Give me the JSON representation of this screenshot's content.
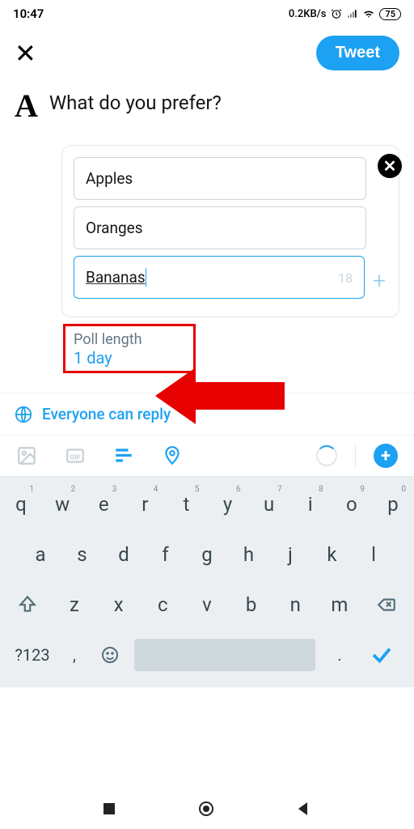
{
  "status": {
    "time": "10:47",
    "speed": "0.2KB/s",
    "battery": "75"
  },
  "header": {
    "tweet_label": "Tweet"
  },
  "compose": {
    "text": "What do you prefer?"
  },
  "poll": {
    "choices": [
      "Apples",
      "Oranges",
      "Bananas"
    ],
    "active_char_count": "18",
    "length_label": "Poll length",
    "length_value": "1 day"
  },
  "reply": {
    "label": "Everyone can reply"
  },
  "keyboard": {
    "row1": [
      "q",
      "w",
      "e",
      "r",
      "t",
      "y",
      "u",
      "i",
      "o",
      "p"
    ],
    "row1_sup": [
      "1",
      "2",
      "3",
      "4",
      "5",
      "6",
      "7",
      "8",
      "9",
      "0"
    ],
    "row2": [
      "a",
      "s",
      "d",
      "f",
      "g",
      "h",
      "j",
      "k",
      "l"
    ],
    "row3": [
      "z",
      "x",
      "c",
      "v",
      "b",
      "n",
      "m"
    ],
    "symbols": "?123",
    "comma": ",",
    "period": "."
  }
}
